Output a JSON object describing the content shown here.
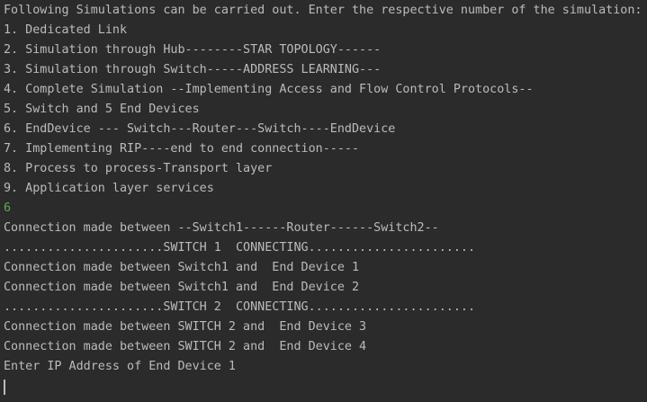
{
  "console": {
    "menu_lines": [
      "Following Simulations can be carried out. Enter the respective number of the simulation:",
      "1. Dedicated Link",
      "2. Simulation through Hub--------STAR TOPOLOGY------",
      "3. Simulation through Switch-----ADDRESS LEARNING---",
      "4. Complete Simulation --Implementing Access and Flow Control Protocols--",
      "5. Switch and 5 End Devices",
      "6. EndDevice --- Switch---Router---Switch----EndDevice",
      "7. Implementing RIP----end to end connection-----",
      "8. Process to process-Transport layer",
      "9. Application layer services"
    ],
    "user_input": "6",
    "output_lines": [
      "Connection made between --Switch1------Router------Switch2--",
      "......................SWITCH 1  CONNECTING.......................",
      "Connection made between Switch1 and  End Device 1",
      "Connection made between Switch1 and  End Device 2",
      "......................SWITCH 2  CONNECTING.......................",
      "Connection made between SWITCH 2 and  End Device 3",
      "Connection made between SWITCH 2 and  End Device 4",
      "Enter IP Address of End Device 1"
    ],
    "colors": {
      "background": "#2b2b2b",
      "text": "#bbbbbb",
      "user_input": "#5faa4f"
    }
  }
}
